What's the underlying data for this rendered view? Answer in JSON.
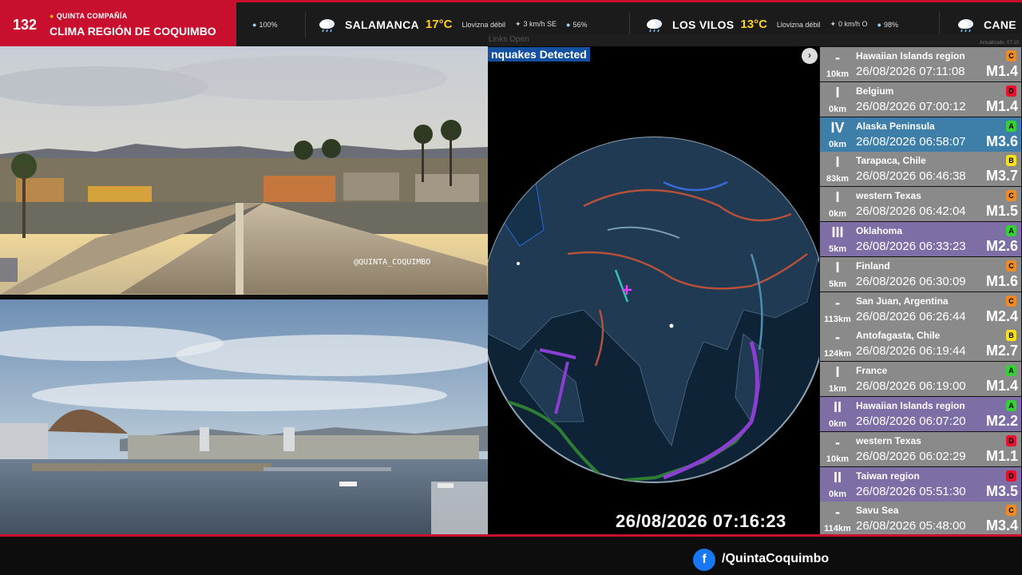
{
  "brand": {
    "number": "132",
    "subtitle": "QUINTA COMPAÑÍA",
    "title": "CLIMA REGIÓN DE COQUIMBO"
  },
  "ticker": {
    "partial_humidity": "100%",
    "items": [
      {
        "icon": "rain-cloud-icon",
        "city": "SALAMANCA",
        "temp": "17°C",
        "condition": "Llovizna débil",
        "wind": "3 km/h SE",
        "humidity": "56%"
      },
      {
        "icon": "rain-cloud-icon",
        "city": "LOS VILOS",
        "temp": "13°C",
        "condition": "Llovizna débil",
        "wind": "0 km/h O",
        "humidity": "98%"
      },
      {
        "icon": "rain-cloud-icon",
        "city": "CANE"
      }
    ],
    "links_text": "Links   Open",
    "updated_text": "Actualizado: 07:10"
  },
  "cameras": {
    "top_watermark": "@QUINTA_COQUIMBO"
  },
  "globe": {
    "label": "nquakes Detected",
    "arrow_icon": "chevron-right-icon",
    "clock": "26/08/2026 07:16:23"
  },
  "quakes": [
    {
      "intensity": "-",
      "depth": "10km",
      "place": "Hawaiian Islands region",
      "time": "26/08/2026 07:11:08",
      "mag": "M1.4",
      "badge": "C",
      "badge_color": "#f08a24",
      "row": "gray"
    },
    {
      "intensity": "I",
      "depth": "0km",
      "place": "Belgium",
      "time": "26/08/2026 07:00:12",
      "mag": "M1.4",
      "badge": "D",
      "badge_color": "#e8102a",
      "row": "gray"
    },
    {
      "intensity": "IV",
      "depth": "0km",
      "place": "Alaska Peninsula",
      "time": "26/08/2026 06:58:07",
      "mag": "M3.6",
      "badge": "A",
      "badge_color": "#34d036",
      "row": "blue"
    },
    {
      "intensity": "I",
      "depth": "83km",
      "place": "Tarapaca, Chile",
      "time": "26/08/2026 06:46:38",
      "mag": "M3.7",
      "badge": "B",
      "badge_color": "#ffe01a",
      "row": "gray"
    },
    {
      "intensity": "I",
      "depth": "0km",
      "place": "western Texas",
      "time": "26/08/2026 06:42:04",
      "mag": "M1.5",
      "badge": "C",
      "badge_color": "#f08a24",
      "row": "gray"
    },
    {
      "intensity": "III",
      "depth": "5km",
      "place": "Oklahoma",
      "time": "26/08/2026 06:33:23",
      "mag": "M2.6",
      "badge": "A",
      "badge_color": "#34d036",
      "row": "purple"
    },
    {
      "intensity": "I",
      "depth": "5km",
      "place": "Finland",
      "time": "26/08/2026 06:30:09",
      "mag": "M1.6",
      "badge": "C",
      "badge_color": "#f08a24",
      "row": "gray"
    },
    {
      "intensity": "-",
      "depth": "113km",
      "place": "San Juan, Argentina",
      "time": "26/08/2026 06:26:44",
      "mag": "M2.4",
      "badge": "C",
      "badge_color": "#f08a24",
      "row": "gray"
    },
    {
      "intensity": "-",
      "depth": "124km",
      "place": "Antofagasta, Chile",
      "time": "26/08/2026 06:19:44",
      "mag": "M2.7",
      "badge": "B",
      "badge_color": "#ffe01a",
      "row": "gray"
    },
    {
      "intensity": "I",
      "depth": "1km",
      "place": "France",
      "time": "26/08/2026 06:19:00",
      "mag": "M1.4",
      "badge": "A",
      "badge_color": "#34d036",
      "row": "gray"
    },
    {
      "intensity": "II",
      "depth": "0km",
      "place": "Hawaiian Islands region",
      "time": "26/08/2026 06:07:20",
      "mag": "M2.2",
      "badge": "A",
      "badge_color": "#34d036",
      "row": "purple"
    },
    {
      "intensity": "-",
      "depth": "10km",
      "place": "western Texas",
      "time": "26/08/2026 06:02:29",
      "mag": "M1.1",
      "badge": "D",
      "badge_color": "#e8102a",
      "row": "gray"
    },
    {
      "intensity": "II",
      "depth": "0km",
      "place": "Taiwan region",
      "time": "26/08/2026 05:51:30",
      "mag": "M3.5",
      "badge": "D",
      "badge_color": "#e8102a",
      "row": "purple"
    },
    {
      "intensity": "-",
      "depth": "114km",
      "place": "Savu Sea",
      "time": "26/08/2026 05:48:00",
      "mag": "M3.4",
      "badge": "C",
      "badge_color": "#f08a24",
      "row": "gray"
    }
  ],
  "footer": {
    "fb_icon": "facebook-icon",
    "handle": "/QuintaCoquimbo"
  },
  "colors": {
    "brand_red": "#c8102e",
    "temp_yellow": "#ffd21a",
    "row_gray": "#8a8a8a",
    "row_blue": "#3d7fa8",
    "row_purple": "#7d6fa6"
  }
}
